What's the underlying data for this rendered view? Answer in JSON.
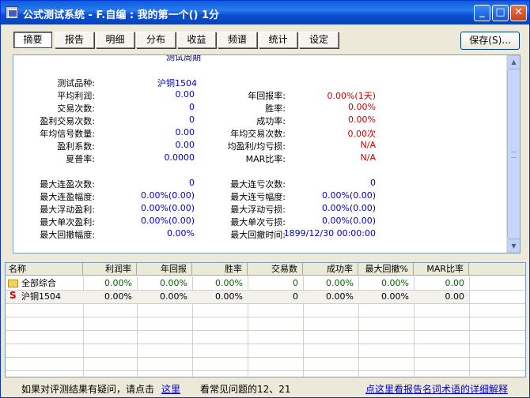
{
  "window": {
    "title": "公式测试系统 - F.自编 : 我的第一个() 1分"
  },
  "tabs": [
    "摘要",
    "报告",
    "明细",
    "分布",
    "收益",
    "频谱",
    "统计",
    "设定"
  ],
  "save_label": "保存(S)...",
  "summary": {
    "cut_text": "测试周期",
    "left": [
      {
        "label": "测试品种:",
        "value": "沪铜1504"
      },
      {
        "label": "平均利润:",
        "value": "0.00"
      },
      {
        "label": "交易次数:",
        "value": "0"
      },
      {
        "label": "盈利交易次数:",
        "value": "0"
      },
      {
        "label": "年均信号数量:",
        "value": "0.00"
      },
      {
        "label": "盈利系数:",
        "value": "0.00"
      },
      {
        "label": "夏普率:",
        "value": "0.0000"
      },
      {
        "label": "最大连盈次数:",
        "value": "0"
      },
      {
        "label": "最大连盈幅度:",
        "value": "0.00%(0.00)"
      },
      {
        "label": "最大浮动盈利:",
        "value": "0.00%(0.00)"
      },
      {
        "label": "最大单次盈利:",
        "value": "0.00%(0.00)"
      },
      {
        "label": "最大回撤幅度:",
        "value": "0.00%"
      }
    ],
    "right": [
      {
        "label": "年回报率:",
        "value": "0.00%(1天)"
      },
      {
        "label": "胜率:",
        "value": "0.00%"
      },
      {
        "label": "成功率:",
        "value": "0.00%"
      },
      {
        "label": "年均交易次数:",
        "value": "0.00次"
      },
      {
        "label": "均盈利/均亏损:",
        "value": "N/A"
      },
      {
        "label": "MAR比率:",
        "value": "N/A"
      },
      {
        "label": "最大连亏次数:",
        "value": "0"
      },
      {
        "label": "最大连亏幅度:",
        "value": "0.00%(0.00)"
      },
      {
        "label": "最大浮动亏损:",
        "value": "0.00%(0.00)"
      },
      {
        "label": "最大单次亏损:",
        "value": "0.00%(0.00)"
      },
      {
        "label": "最大回撤时间:",
        "value": "1899/12/30 00:00:00"
      }
    ]
  },
  "table": {
    "headers": [
      "名称",
      "利润率",
      "年回报",
      "胜率",
      "交易数",
      "成功率",
      "最大回撤%",
      "MAR比率"
    ],
    "rows": [
      {
        "icon": "folder-icon",
        "name": "全部综合",
        "cells": [
          "0.00%",
          "0.00%",
          "0.00%",
          "0",
          "0.00%",
          "0.00%",
          "0.00"
        ]
      },
      {
        "icon": "s-icon",
        "icon_glyph": "S",
        "name": "沪铜1504",
        "cells": [
          "0.00%",
          "0.00%",
          "0.00%",
          "0",
          "0.00%",
          "0.00%",
          "0.00"
        ]
      }
    ]
  },
  "footer": {
    "text1": "如果对评测结果有疑问，请点击",
    "link1": "这里",
    "text2": "看常见问题的12、21",
    "link2": "点这里看报告名词术语的详细解释"
  },
  "colors": {
    "positive_value": "#0000cc",
    "negative_value": "#cc0000",
    "table_value": "#006400",
    "title_bar": "#0a5fd8"
  }
}
